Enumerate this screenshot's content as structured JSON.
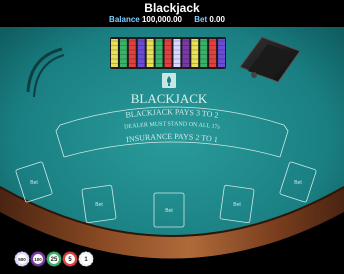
{
  "header": {
    "title": "Blackjack",
    "balance_label": "Balance",
    "balance_value": "100,000.00",
    "bet_label": "Bet",
    "bet_value": "0.00"
  },
  "table": {
    "logo_text": "BLACKJACK",
    "rule_line_1": "BLACKJACK PAYS 3 TO 2",
    "rule_line_2": "DEALER MUST STAND ON ALL 17s",
    "rule_line_3": "INSURANCE PAYS 2 TO 1",
    "bet_spot_label": "Bet"
  },
  "chips": [
    {
      "label": "500",
      "color": "#d9d6ff"
    },
    {
      "label": "100",
      "color": "#7a3aa8"
    },
    {
      "label": "25",
      "color": "#3ab36a"
    },
    {
      "label": "5",
      "color": "#e04040"
    },
    {
      "label": "1",
      "color": "#f2f2f2"
    }
  ],
  "colors": {
    "felt": "#1f8a8a",
    "rail": "#6b3a1e",
    "text": "#cfe9e9"
  }
}
